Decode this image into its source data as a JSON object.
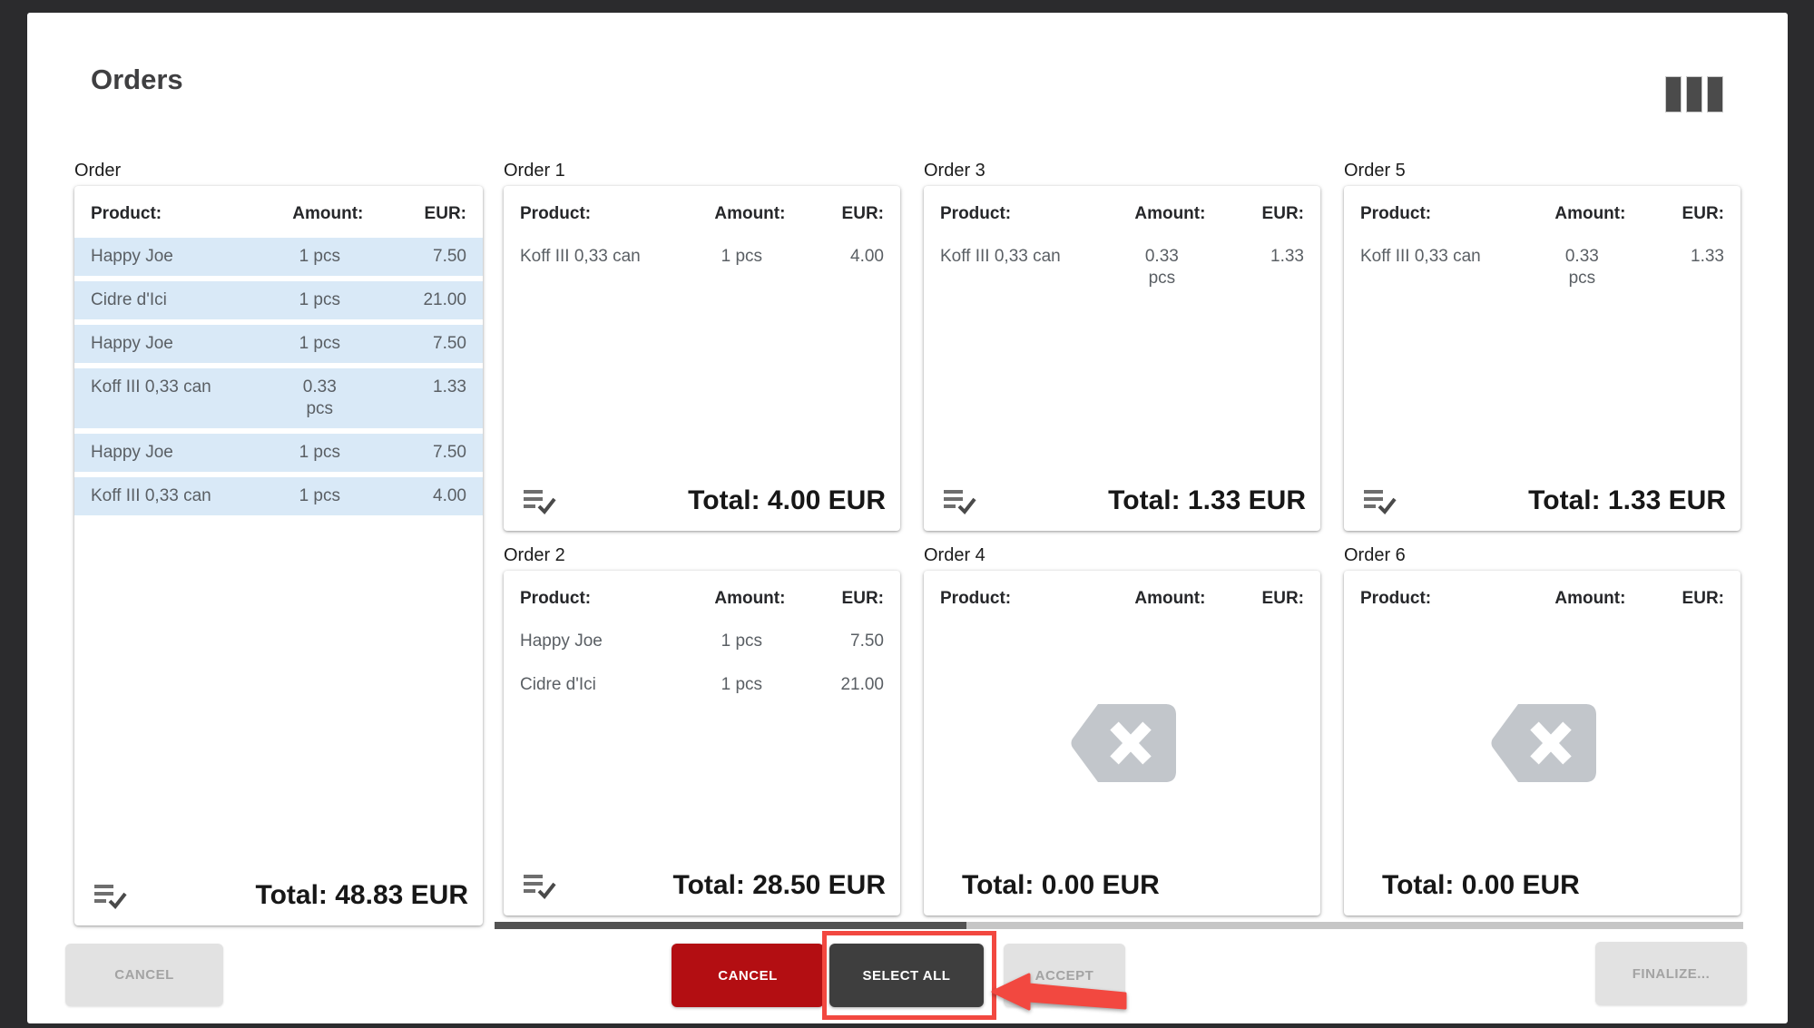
{
  "title": "Orders",
  "header_icon": "columns-view",
  "columns": {
    "product": "Product:",
    "amount": "Amount:",
    "eur": "EUR:"
  },
  "orders": [
    {
      "label": "Order",
      "highlighted": true,
      "empty": false,
      "items": [
        {
          "product": "Happy Joe",
          "amount": "1 pcs",
          "eur": "7.50"
        },
        {
          "product": "Cidre d'Ici",
          "amount": "1 pcs",
          "eur": "21.00"
        },
        {
          "product": "Happy Joe",
          "amount": "1 pcs",
          "eur": "7.50"
        },
        {
          "product": "Koff III 0,33 can",
          "amount": "0.33 pcs",
          "eur": "1.33"
        },
        {
          "product": "Happy Joe",
          "amount": "1 pcs",
          "eur": "7.50"
        },
        {
          "product": "Koff III 0,33 can",
          "amount": "1 pcs",
          "eur": "4.00"
        }
      ],
      "total": "Total: 48.83 EUR"
    },
    {
      "label": "Order 1",
      "highlighted": false,
      "empty": false,
      "items": [
        {
          "product": "Koff III 0,33 can",
          "amount": "1 pcs",
          "eur": "4.00"
        }
      ],
      "total": "Total: 4.00 EUR"
    },
    {
      "label": "Order 2",
      "highlighted": false,
      "empty": false,
      "items": [
        {
          "product": "Happy Joe",
          "amount": "1 pcs",
          "eur": "7.50"
        },
        {
          "product": "Cidre d'Ici",
          "amount": "1 pcs",
          "eur": "21.00"
        }
      ],
      "total": "Total: 28.50 EUR"
    },
    {
      "label": "Order 3",
      "highlighted": false,
      "empty": false,
      "items": [
        {
          "product": "Koff III 0,33 can",
          "amount": "0.33 pcs",
          "eur": "1.33"
        }
      ],
      "total": "Total: 1.33 EUR"
    },
    {
      "label": "Order 4",
      "highlighted": false,
      "empty": true,
      "items": [],
      "total": "Total: 0.00 EUR"
    },
    {
      "label": "Order 5",
      "highlighted": false,
      "empty": false,
      "items": [
        {
          "product": "Koff III 0,33 can",
          "amount": "0.33 pcs",
          "eur": "1.33"
        }
      ],
      "total": "Total: 1.33 EUR"
    },
    {
      "label": "Order 6",
      "highlighted": false,
      "empty": true,
      "items": [],
      "total": "Total: 0.00 EUR"
    }
  ],
  "buttons": {
    "cancel_left": "CANCEL",
    "cancel": "CANCEL",
    "select_all": "SELECT ALL",
    "accept": "ACCEPT",
    "finalize": "FINALIZE..."
  },
  "colors": {
    "accent_red": "#b30e12",
    "annotation_red": "#f24840",
    "highlight_row": "#d9e9f7",
    "dark_button": "#3e3e3e"
  }
}
